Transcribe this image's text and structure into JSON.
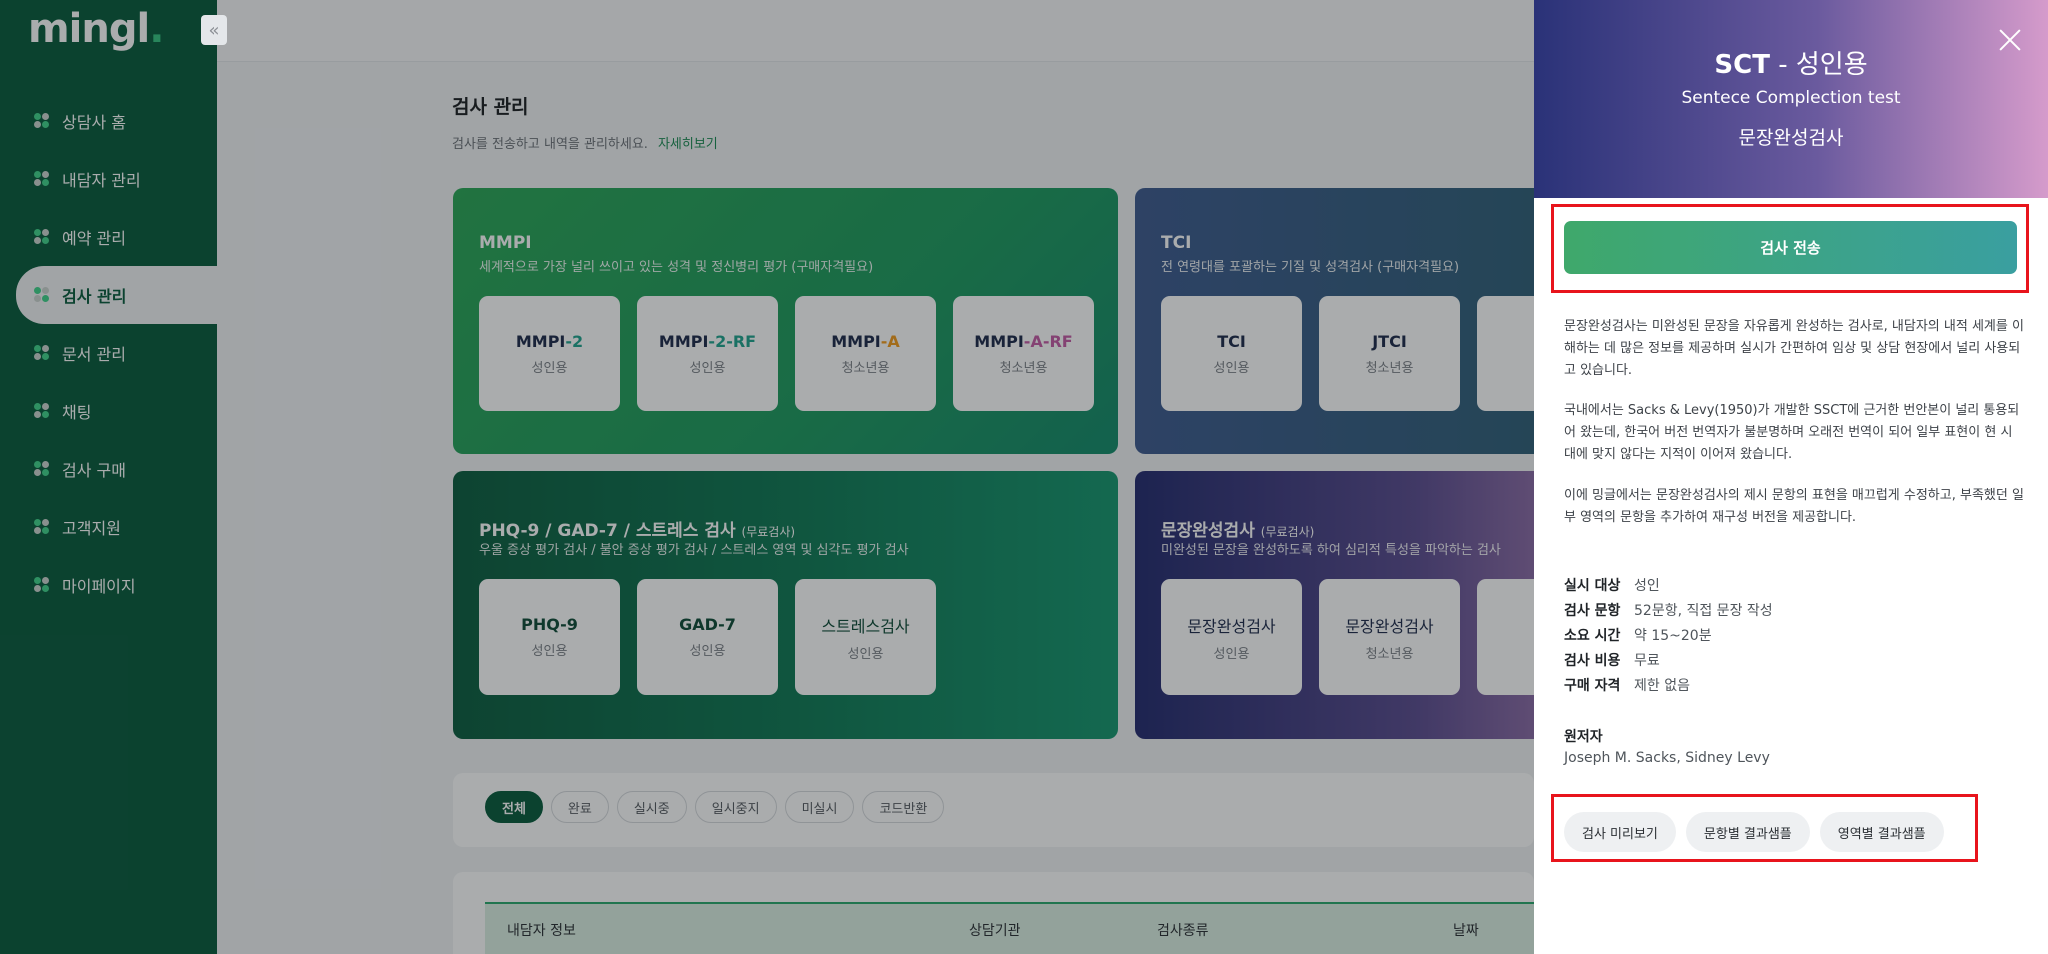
{
  "sidebar": {
    "logo": "mingl",
    "logo_dot": ".",
    "collapse_icon": "«",
    "items": [
      {
        "label": "상담사 홈"
      },
      {
        "label": "내담자 관리"
      },
      {
        "label": "예약 관리"
      },
      {
        "label": "검사 관리"
      },
      {
        "label": "문서 관리"
      },
      {
        "label": "채팅"
      },
      {
        "label": "검사 구매"
      },
      {
        "label": "고객지원"
      },
      {
        "label": "마이페이지"
      }
    ],
    "active_index": 3
  },
  "main": {
    "title": "검사 관리",
    "subtitle": "검사를 전송하고 내역을 관리하세요.",
    "detail_link": "자세히보기"
  },
  "cards": {
    "mmpi": {
      "title": "MMPI",
      "desc": "세계적으로 가장 널리 쓰이고 있는 성격 및 정신병리 평가 (구매자격필요)",
      "tiles": [
        {
          "a": "MMPI",
          "b": "-2",
          "sub": "성인용"
        },
        {
          "a": "MMPI",
          "b": "-2-RF",
          "sub": "성인용"
        },
        {
          "a": "MMPI",
          "b": "-A",
          "sub": "청소년용"
        },
        {
          "a": "MMPI",
          "b": "-A-RF",
          "sub": "청소년용"
        }
      ]
    },
    "tci": {
      "title": "TCI",
      "desc": "전 연령대를 포괄하는 기질 및 성격검사 (구매자격필요)",
      "tiles": [
        {
          "name": "TCI",
          "sub": "성인용"
        },
        {
          "name": "JTCI",
          "sub": "청소년용"
        }
      ]
    },
    "phq": {
      "title": "PHQ-9 / GAD-7 / 스트레스 검사",
      "title_small": "(무료검사)",
      "desc": "우울 증상 평가 검사 / 불안 증상 평가 검사 / 스트레스 영역 및 심각도 평가 검사",
      "tiles": [
        {
          "name": "PHQ-9",
          "sub": "성인용"
        },
        {
          "name": "GAD-7",
          "sub": "성인용"
        },
        {
          "name": "스트레스검사",
          "sub": "성인용"
        }
      ]
    },
    "sct": {
      "title": "문장완성검사",
      "title_small": "(무료검사)",
      "desc": "미완성된 문장을 완성하도록 하여 심리적 특성을 파악하는 검사",
      "tiles": [
        {
          "name": "문장완성검사",
          "sub": "성인용"
        },
        {
          "name": "문장완성검사",
          "sub": "청소년용"
        }
      ]
    }
  },
  "filters": [
    "전체",
    "완료",
    "실시중",
    "일시중지",
    "미실시",
    "코드반환"
  ],
  "table": {
    "headers": [
      "내담자 정보",
      "상담기관",
      "검사종류",
      "날짜"
    ]
  },
  "drawer": {
    "title_bold": "SCT",
    "title_rest": " - 성인용",
    "subtitle_en": "Sentece Complection test",
    "subtitle_ko": "문장완성검사",
    "send_button": "검사 전송",
    "paragraphs": [
      "문장완성검사는 미완성된 문장을 자유롭게 완성하는 검사로, 내담자의 내적 세계를 이해하는 데 많은 정보를 제공하며 실시가 간편하여 임상 및 상담 현장에서 널리 사용되고 있습니다.",
      "국내에서는 Sacks & Levy(1950)가 개발한 SSCT에 근거한 번안본이 널리 통용되어 왔는데, 한국어 버전 번역자가 불분명하며 오래전 번역이 되어 일부 표현이 현 시대에 맞지 않다는 지적이 이어져 왔습니다.",
      "이에 밍글에서는 문장완성검사의 제시 문항의 표현을 매끄럽게 수정하고, 부족했던 일부 영역의 문항을 추가하여 재구성 버전을 제공합니다."
    ],
    "meta": [
      {
        "k": "실시 대상",
        "v": "성인"
      },
      {
        "k": "검사 문항",
        "v": "52문항, 직접 문장 작성"
      },
      {
        "k": "소요 시간",
        "v": "약 15~20분"
      },
      {
        "k": "검사 비용",
        "v": "무료"
      },
      {
        "k": "구매 자격",
        "v": "제한 없음"
      }
    ],
    "author_label": "원저자",
    "author_value": "Joseph M. Sacks, Sidney Levy",
    "sample_buttons": [
      "검사 미리보기",
      "문항별 결과샘플",
      "영역별 결과샘플"
    ]
  }
}
